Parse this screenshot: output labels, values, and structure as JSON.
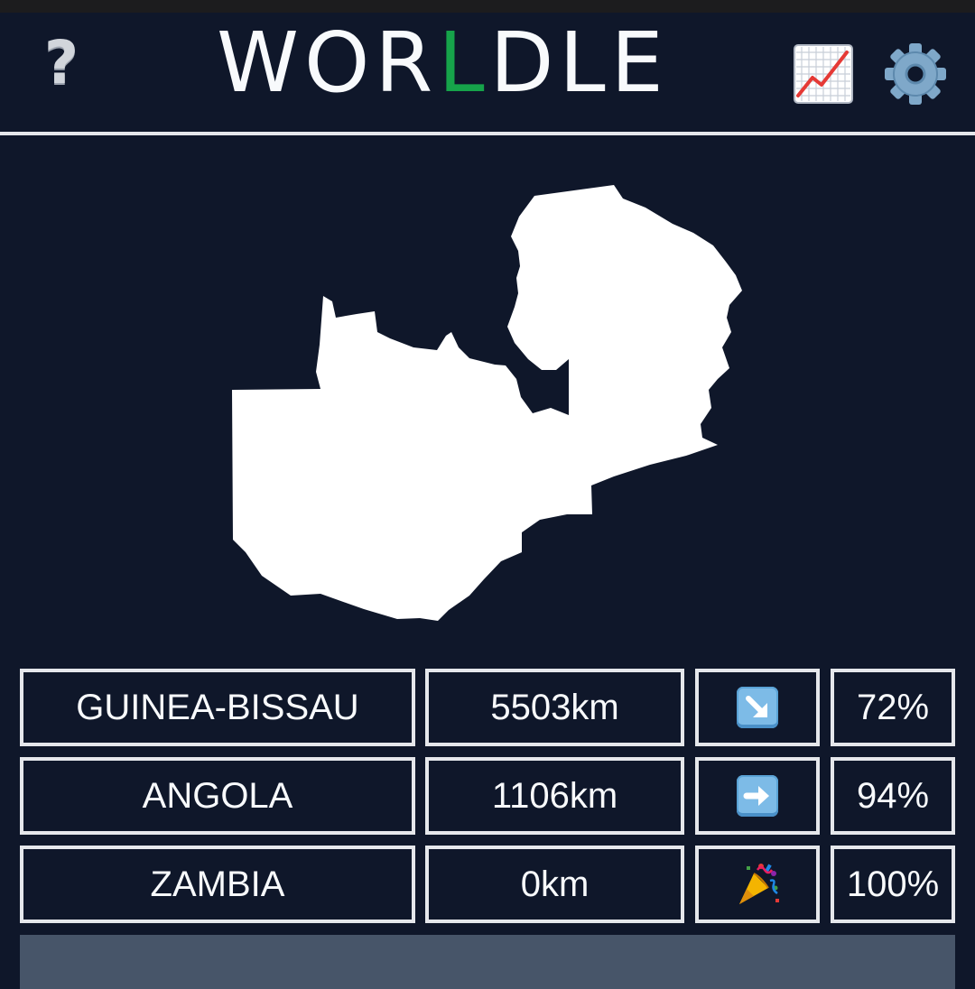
{
  "app": {
    "title_parts": [
      "WOR",
      "L",
      "DLE"
    ],
    "help_label": "?"
  },
  "icons": {
    "help": "question-mark-icon",
    "stats": "chart-increasing-icon",
    "settings": "gear-icon",
    "mystery_country": "country-silhouette-icon"
  },
  "colors": {
    "background": "#0f172a",
    "title_accent": "#16a34a",
    "cell_border": "#e5e7eb",
    "input_bar": "#475569"
  },
  "guesses": [
    {
      "country": "GUINEA-BISSAU",
      "distance": "5503km",
      "direction_icon": "arrow-down-right-icon",
      "proximity": "72%"
    },
    {
      "country": "ANGOLA",
      "distance": "1106km",
      "direction_icon": "arrow-right-icon",
      "proximity": "94%"
    },
    {
      "country": "ZAMBIA",
      "distance": "0km",
      "direction_icon": "party-popper-icon",
      "proximity": "100%"
    }
  ],
  "guess_input": {
    "placeholder": ""
  }
}
